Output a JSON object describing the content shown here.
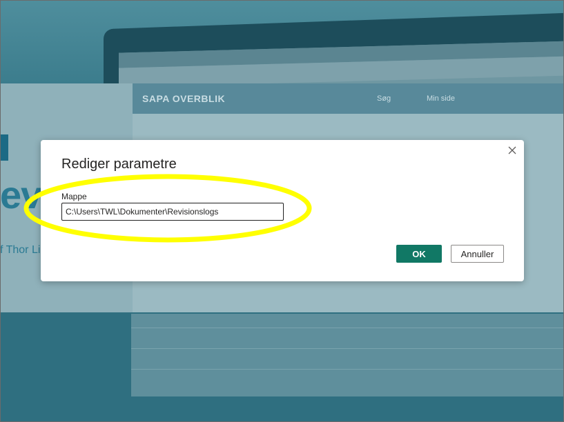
{
  "dialog": {
    "title": "Rediger parametre",
    "field_label": "Mappe",
    "folder_value": "C:\\Users\\TWL\\Dokumenter\\Revisionslogs",
    "ok_label": "OK",
    "cancel_label": "Annuller",
    "close_icon": "close-icon"
  },
  "background": {
    "app_title": "SAPA OVERBLIK",
    "nav_items": [
      "Søg",
      "Min side"
    ],
    "left_big_text": "evis",
    "left_sub_text": "f Thor Li"
  },
  "colors": {
    "ok_button": "#117865",
    "highlight_ellipse": "#ffff00",
    "overlay": "#2f6f80"
  }
}
